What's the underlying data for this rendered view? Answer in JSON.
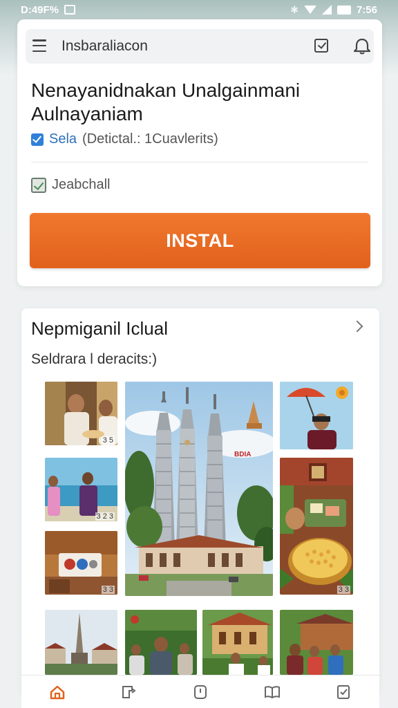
{
  "status_bar": {
    "left_text": "D:49F%",
    "right_text": "7:56"
  },
  "search": {
    "text": "Insbaraliacon"
  },
  "app": {
    "title": "Nenayanidnakan Unalgainmani Aulnayaniam",
    "checkbox_primary": "Sela",
    "checkbox_secondary": "(Detictal.: 1Cuavlerits)",
    "secondary_label": "Jeabchall"
  },
  "install_button": {
    "label": "INSTAL"
  },
  "gallery": {
    "title": "Nepmiganil Iclual",
    "subtitle": "Seldrara l deracits:)",
    "badge_text": "BDIA",
    "thumb_labels": [
      "3 5",
      "3 2 3",
      "3 3",
      "3 3"
    ]
  },
  "colors": {
    "accent": "#e8691f",
    "checkbox": "#2f80d9",
    "active_nav": "#e1611c"
  },
  "icons": {
    "menu": "menu-icon",
    "calendar": "calendar-check-icon",
    "bell": "bell-icon",
    "nav": [
      "home-icon",
      "tag-icon",
      "clock-icon",
      "book-icon",
      "checklist-icon"
    ]
  }
}
